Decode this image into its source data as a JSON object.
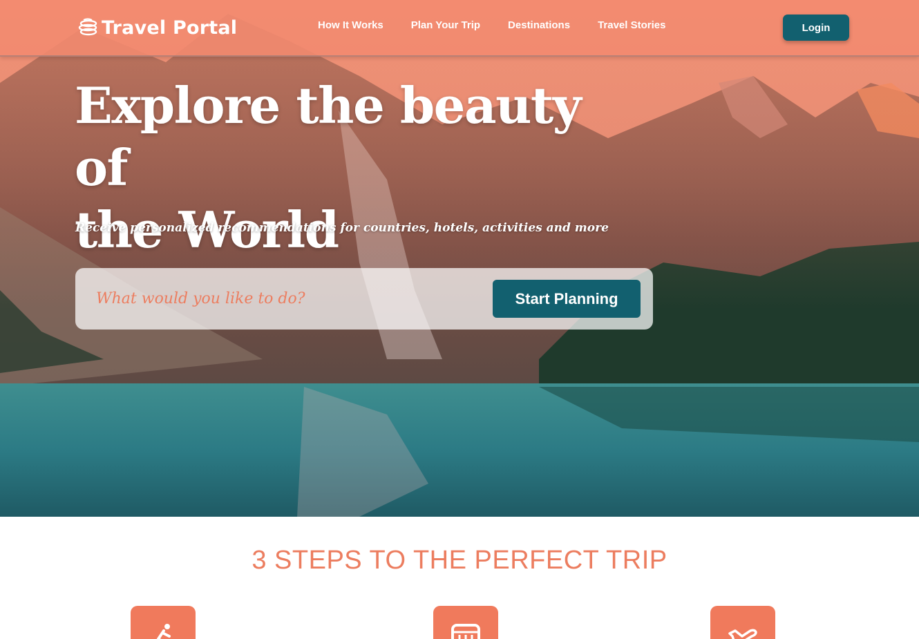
{
  "brand": {
    "name": "Travel Portal",
    "icon": "stacked-plates-icon"
  },
  "nav": {
    "links": [
      "How It Works",
      "Plan Your Trip",
      "Destinations",
      "Travel Stories"
    ],
    "login_label": "Login"
  },
  "hero": {
    "headline_line1": "Explore the beauty of",
    "headline_line2": "the World",
    "subheadline": "Receive personalized recommendations for countries, hotels, activities and more",
    "search": {
      "placeholder": "What would you like to do?",
      "value": ""
    },
    "cta_label": "Start Planning"
  },
  "steps": {
    "title": "3 STEPS TO THE PERFECT TRIP",
    "cards": [
      {
        "icon": "person-activity-icon"
      },
      {
        "icon": "calendar-icon"
      },
      {
        "icon": "airplane-icon"
      }
    ]
  },
  "colors": {
    "accent": "#ec7d5f",
    "primary_button": "#12606f",
    "navbar_bg": "#f28a70"
  }
}
